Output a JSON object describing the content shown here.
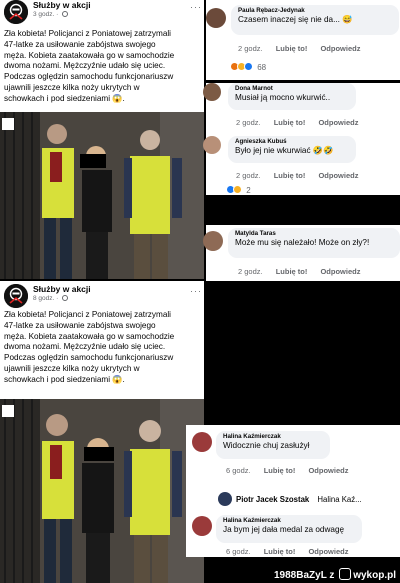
{
  "post1": {
    "page_name": "Służby w akcji",
    "time": "3 godz.",
    "text_lines": [
      "Zła kobieta! Policjanci z Poniatowej zatrzymali",
      "47-latke za usiłowanie zabójstwa swojego",
      "męża. Kobieta zaatakowała go w samochodzie",
      "dwoma nożami.  Mężczyźnie udało się uciec.",
      "Podczas oględzin samochodu funkcjonariuszw",
      "ujawnili jeszcze kilka noży ukrytych w",
      "schowkach i pod siedzeniami 😱."
    ]
  },
  "post2": {
    "page_name": "Służby w akcji",
    "time": "8 godz.",
    "text_lines": [
      "Zła kobieta! Policjanci z Poniatowej zatrzymali",
      "47-latke za usiłowanie zabójstwa swojego",
      "męża. Kobieta zaatakowała go w samochodzie",
      "dwoma nożami.  Mężczyźnie udało się uciec.",
      "Podczas oględzin samochodu funkcjonariuszw",
      "ujawnili jeszcze kilka noży ukrytych w",
      "schowkach i pod siedzeniami 😱."
    ]
  },
  "comments_top": [
    {
      "author": "Paula Rębacz-Jedynak",
      "text": "Czasem inaczej się nie da... 😅",
      "time": "2 godz.",
      "like": "Lubię to!",
      "reply": "Odpowiedz",
      "reaction_count": "68"
    },
    {
      "author": "Dona Marnot",
      "text": "Musiał ją mocno wkurwić..",
      "time": "2 godz.",
      "like": "Lubię to!",
      "reply": "Odpowiedz"
    },
    {
      "author": "Agnieszka Kubuś",
      "text": "Było jej nie wkurwiać 🤣🤣",
      "time": "2 godz.",
      "like": "Lubię to!",
      "reply": "Odpowiedz",
      "reaction_count": "2"
    },
    {
      "author": "Matylda Taras",
      "text": "Może mu się należało! Może on zły?!",
      "time": "2 godz.",
      "like": "Lubię to!",
      "reply": "Odpowiedz"
    }
  ],
  "comments_bottom": [
    {
      "author": "Halina Kaźmierczak",
      "text": "Widocznie chuj zasłużył",
      "time": "6 godz.",
      "like": "Lubię to!",
      "reply": "Odpowiedz"
    },
    {
      "author": "Piotr Jacek Szostak",
      "text": "Halina Kaź..."
    },
    {
      "author": "Halina Kaźmierczak",
      "text": "Ja bym jej dała medal za odwagę",
      "time": "6 godz.",
      "like": "Lubię to!",
      "reply": "Odpowiedz"
    }
  ],
  "watermark": {
    "user": "1988BaZyL",
    "sep": "z",
    "site": "wykop.pl"
  },
  "colors": {
    "text": "#050505",
    "muted": "#65676b",
    "bubble": "#f0f2f5",
    "divider": "#000000"
  }
}
